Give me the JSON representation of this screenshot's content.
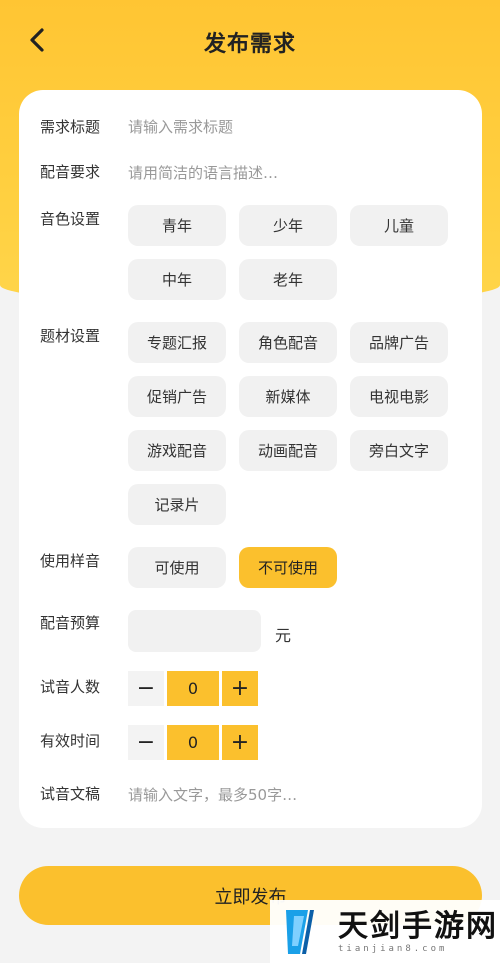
{
  "header": {
    "title": "发布需求"
  },
  "form": {
    "title_field": {
      "label": "需求标题",
      "placeholder": "请输入需求标题"
    },
    "requirement_field": {
      "label": "配音要求",
      "placeholder": "请用简洁的语言描述…"
    },
    "voice": {
      "label": "音色设置",
      "options": [
        "青年",
        "少年",
        "儿童",
        "中年",
        "老年"
      ]
    },
    "topic": {
      "label": "题材设置",
      "options": [
        "专题汇报",
        "角色配音",
        "品牌广告",
        "促销广告",
        "新媒体",
        "电视电影",
        "游戏配音",
        "动画配音",
        "旁白文字",
        "记录片"
      ]
    },
    "sample": {
      "label": "使用样音",
      "options": [
        "可使用",
        "不可使用"
      ],
      "selected": "不可使用"
    },
    "budget": {
      "label": "配音预算",
      "value": "",
      "unit": "元"
    },
    "audition_count": {
      "label": "试音人数",
      "value": "0",
      "minus": "−",
      "plus": "+"
    },
    "valid_time": {
      "label": "有效时间",
      "value": "0",
      "minus": "−",
      "plus": "+"
    },
    "script": {
      "label": "试音文稿",
      "placeholder": "请输入文字，最多50字…"
    }
  },
  "submit": {
    "label": "立即发布"
  },
  "watermark": {
    "title": "天剑手游网",
    "subtitle": "tianjian8.com"
  },
  "colors": {
    "accent": "#fbc02d",
    "header_bg": "#ffc533",
    "page_bg": "#f3f3f3"
  },
  "icons": {
    "back": "back-arrow-icon"
  }
}
